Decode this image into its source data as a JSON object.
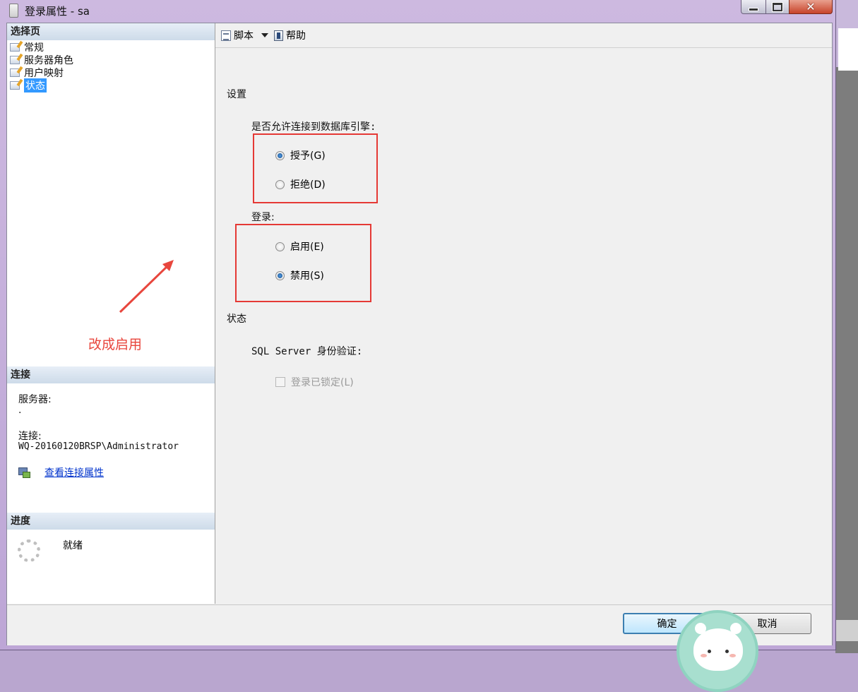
{
  "window": {
    "title": "登录属性 - sa"
  },
  "left": {
    "select_page_header": "选择页",
    "pages": [
      {
        "label": "常规"
      },
      {
        "label": "服务器角色"
      },
      {
        "label": "用户映射"
      },
      {
        "label": "状态",
        "selected": true
      }
    ],
    "connection": {
      "header": "连接",
      "server_label": "服务器:",
      "server_value": ".",
      "conn_label": "连接:",
      "conn_value": "WQ-20160120BRSP\\Administrator",
      "view_props_link": "查看连接属性"
    },
    "progress": {
      "header": "进度",
      "status": "就绪"
    }
  },
  "toolbar": {
    "script_label": "脚本",
    "help_label": "帮助"
  },
  "content": {
    "settings_title": "设置",
    "permission_label": "是否允许连接到数据库引擎:",
    "grant_label": "授予(G)",
    "deny_label": "拒绝(D)",
    "permission_selected": "grant",
    "login_label": "登录:",
    "enable_label": "启用(E)",
    "disable_label": "禁用(S)",
    "login_selected": "disable",
    "status_title": "状态",
    "sql_auth_label": "SQL Server 身份验证:",
    "locked_label": "登录已锁定(L)",
    "locked_checked": false
  },
  "annotation": {
    "text": "改成启用",
    "color": "#e8463d"
  },
  "footer": {
    "ok_label": "确定",
    "cancel_label": "取消"
  },
  "colors": {
    "selection": "#3399ff",
    "section_header": "#cddbe9",
    "link": "#0033cc",
    "highlight_box": "#e53935"
  }
}
